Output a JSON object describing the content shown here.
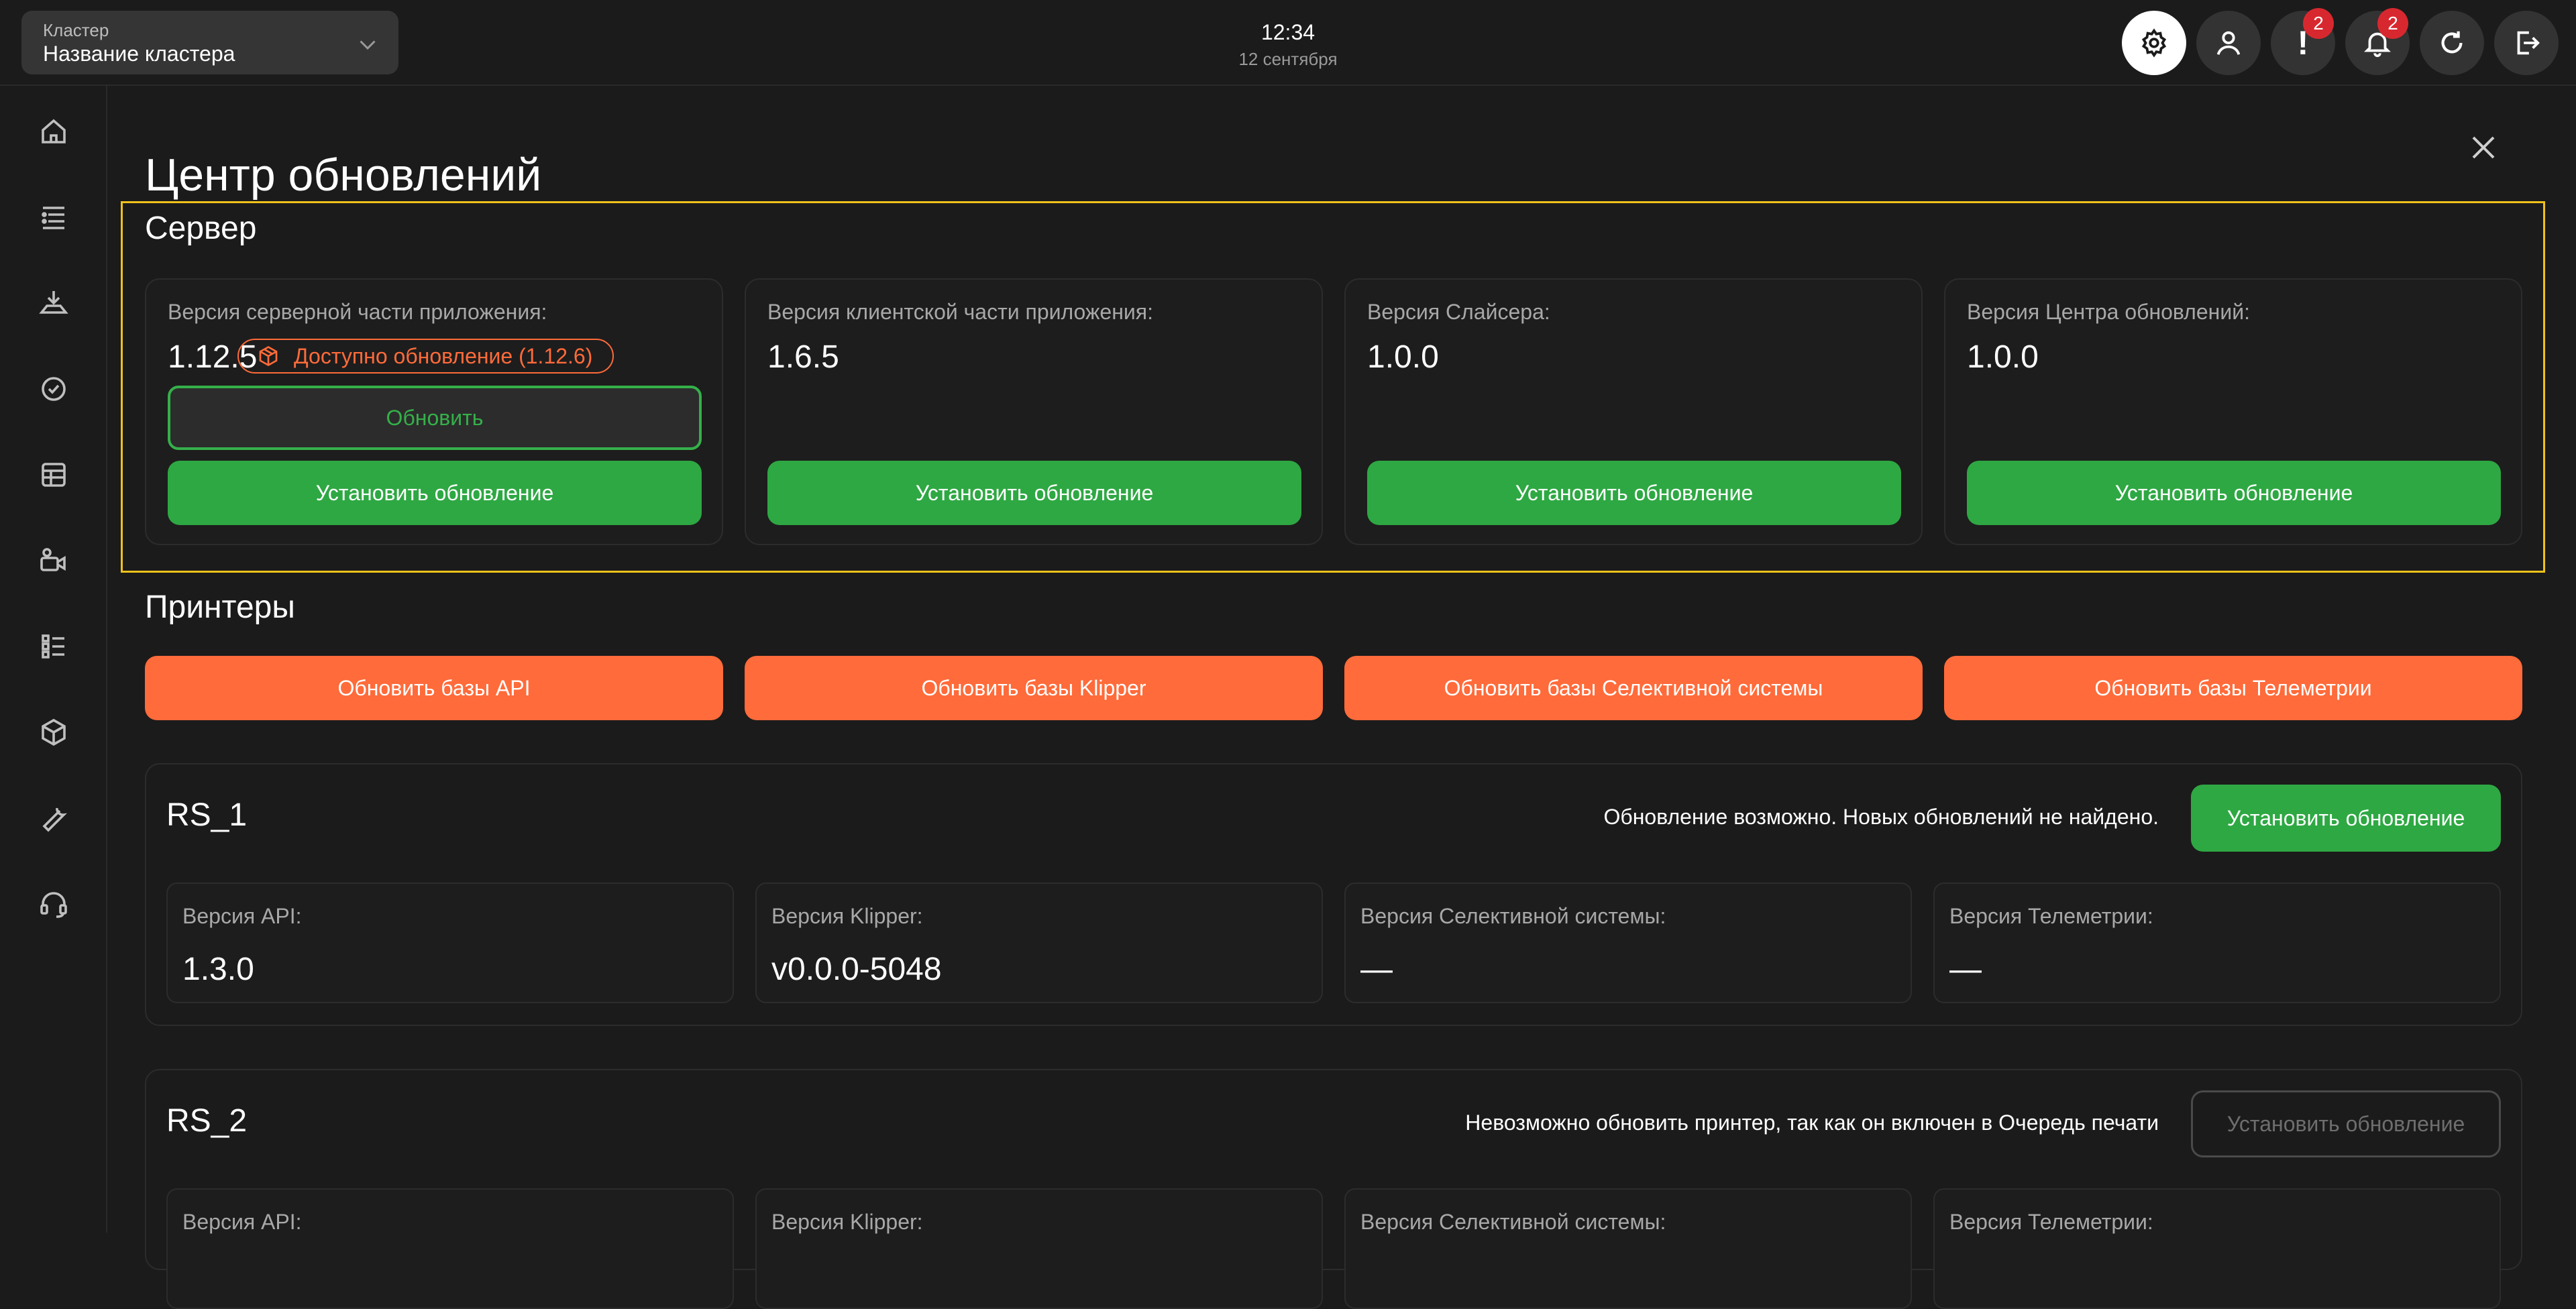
{
  "header": {
    "cluster_label": "Кластер",
    "cluster_name": "Название кластера",
    "time": "12:34",
    "date": "12 сентября",
    "alerts_badge": "2",
    "notifications_badge": "2"
  },
  "page": {
    "title": "Центр обновлений"
  },
  "server": {
    "title": "Сервер",
    "cards": [
      {
        "label": "Версия серверной части приложения:",
        "version": "1.12.5",
        "update_available": "Доступно обновление (1.12.6)",
        "update_button": "Обновить",
        "install_button": "Установить обновление"
      },
      {
        "label": "Версия клиентской части приложения:",
        "version": "1.6.5",
        "install_button": "Установить обновление"
      },
      {
        "label": "Версия Слайсера:",
        "version": "1.0.0",
        "install_button": "Установить обновление"
      },
      {
        "label": "Версия Центра обновлений:",
        "version": "1.0.0",
        "install_button": "Установить обновление"
      }
    ]
  },
  "printers": {
    "title": "Принтеры",
    "db_buttons": [
      "Обновить базы API",
      "Обновить базы Klipper",
      "Обновить базы Селективной системы",
      "Обновить базы Телеметрии"
    ],
    "list": [
      {
        "name": "RS_1",
        "status": "Обновление возможно. Новых обновлений не найдено.",
        "install_button": "Установить обновление",
        "enabled": true,
        "fields": [
          {
            "label": "Версия API:",
            "value": "1.3.0"
          },
          {
            "label": "Версия Klipper:",
            "value": "v0.0.0-5048"
          },
          {
            "label": "Версия Селективной системы:",
            "value": "—"
          },
          {
            "label": "Версия Телеметрии:",
            "value": "—"
          }
        ]
      },
      {
        "name": "RS_2",
        "status": "Невозможно обновить принтер, так как он включен в Очередь печати",
        "install_button": "Установить обновление",
        "enabled": false,
        "fields": [
          {
            "label": "Версия API:",
            "value": ""
          },
          {
            "label": "Версия Klipper:",
            "value": ""
          },
          {
            "label": "Версия Селективной системы:",
            "value": ""
          },
          {
            "label": "Версия Телеметрии:",
            "value": ""
          }
        ]
      }
    ]
  },
  "colors": {
    "background": "#1b1b1b",
    "accent_green": "#2ea843",
    "accent_orange": "#ff6b3a",
    "highlight_yellow": "#f0c21a",
    "badge_red": "#d8282f"
  },
  "icons": {
    "sidebar": [
      "home-icon",
      "list-icon",
      "printer-icon",
      "check-circle-icon",
      "table-icon",
      "camera-icon",
      "grid-list-icon",
      "cube-icon",
      "wrench-icon",
      "headset-icon"
    ],
    "top": [
      "gear-icon",
      "user-icon",
      "alert-icon",
      "bell-icon",
      "refresh-icon",
      "logout-icon"
    ]
  }
}
